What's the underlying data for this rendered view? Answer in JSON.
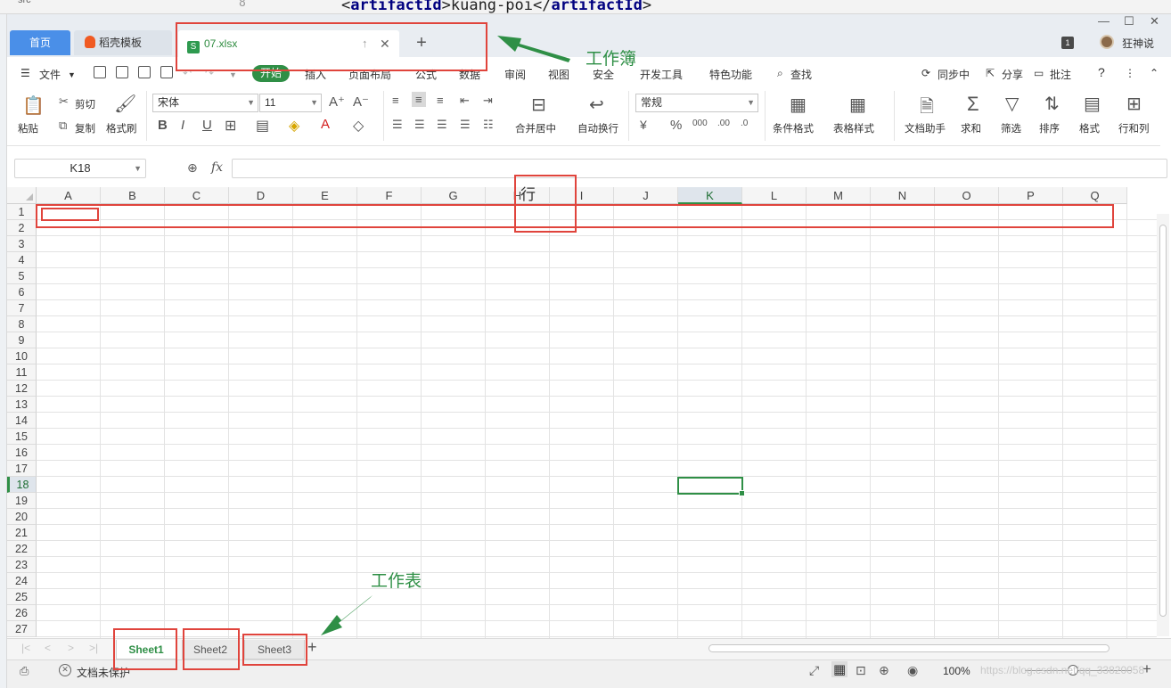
{
  "background_code": {
    "line_number": "8",
    "src_label": "src",
    "open_tag": "<",
    "tag_name": "artifactId",
    "close_open": ">",
    "value": "kuang-poi",
    "end_open": "</",
    "end_tag": "artifactId",
    "end_close": ">"
  },
  "tabs": {
    "home": "首页",
    "template": "稻壳模板",
    "file": "07.xlsx",
    "file_icon": "S",
    "add": "+"
  },
  "titlebar": {
    "count_badge": "1",
    "user_name": "狂神说"
  },
  "menu": {
    "file": "文件",
    "start": "开始",
    "items": [
      "插入",
      "页面布局",
      "公式",
      "数据",
      "审阅",
      "视图",
      "安全",
      "开发工具",
      "特色功能"
    ],
    "search": "查找",
    "sync": "同步中",
    "share": "分享",
    "comment": "批注",
    "help": "?"
  },
  "ribbon": {
    "paste": "粘贴",
    "cut": "剪切",
    "copy": "复制",
    "format_painter": "格式刷",
    "font_name": "宋体",
    "font_size": "11",
    "merge_center": "合并居中",
    "auto_wrap": "自动换行",
    "number_format": "常规",
    "conditional_format": "条件格式",
    "table_style": "表格样式",
    "doc_assistant": "文档助手",
    "sum": "求和",
    "filter": "筛选",
    "sort": "排序",
    "format": "格式",
    "rows_cols": "行和列"
  },
  "formula_bar": {
    "name_box": "K18",
    "fx_label": "fx",
    "value": ""
  },
  "grid": {
    "columns": [
      "A",
      "B",
      "C",
      "D",
      "E",
      "F",
      "G",
      "H",
      "I",
      "J",
      "K",
      "L",
      "M",
      "N",
      "O",
      "P",
      "Q"
    ],
    "rows": [
      "1",
      "2",
      "3",
      "4",
      "5",
      "6",
      "7",
      "8",
      "9",
      "10",
      "11",
      "12",
      "13",
      "14",
      "15",
      "16",
      "17",
      "18",
      "19",
      "20",
      "21",
      "22",
      "23",
      "24",
      "25",
      "26",
      "27"
    ],
    "active_column": "K",
    "active_row": "18"
  },
  "sheets": {
    "tabs": [
      "Sheet1",
      "Sheet2",
      "Sheet3"
    ],
    "active": "Sheet1",
    "add": "+"
  },
  "status": {
    "doc_protect": "文档未保护",
    "zoom": "100%",
    "watermark": "https://blog.csdn.net/qq_33820058"
  },
  "annotations": {
    "workbook_label": "工作簿",
    "worksheet_label": "工作表",
    "row_label": "行",
    "color": "#2f8f46",
    "box_color": "#e0443c"
  },
  "colors": {
    "accent_green": "#2f8f46",
    "home_tab_blue": "#4a8fe8"
  }
}
